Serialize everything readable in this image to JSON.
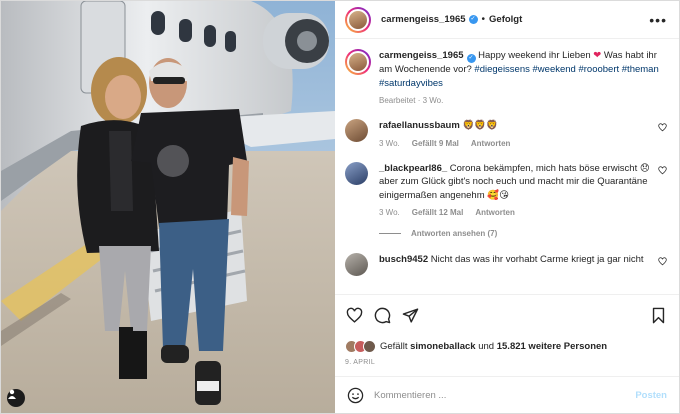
{
  "post": {
    "username": "carmengeiss_1965",
    "follow_status": "Gefolgt",
    "more_menu": "•••"
  },
  "caption": {
    "username": "carmengeiss_1965",
    "text": "Happy weekend ihr Lieben",
    "text2": "Was habt ihr am Wochenende vor?",
    "hashtags": "#diegeissens #weekend #rooobert #theman #saturdayvibes",
    "meta": "Bearbeitet · 3 Wo."
  },
  "comments": [
    {
      "username": "rafaellanussbaum",
      "text": "🦁🦁🦁",
      "age": "3 Wo.",
      "likes": "Gefällt 9 Mal",
      "reply": "Antworten"
    },
    {
      "username": "_blackpearl86_",
      "text": "Corona bekämpfen, mich hats böse erwischt 😞 aber zum Glück gibt's noch euch und macht mir die Quarantäne einigermaßen angenehm 🥰😘",
      "age": "3 Wo.",
      "likes": "Gefällt 12 Mal",
      "reply": "Antworten",
      "view_replies": "Antworten ansehen (7)"
    },
    {
      "username": "busch9452",
      "text": "Nicht das was ihr vorhabt Carme kriegt ja gar nicht"
    }
  ],
  "likes": {
    "prefix": "Gefällt",
    "user": "simoneballack",
    "middle": "und",
    "count": "15.821 weitere Personen"
  },
  "date": "9. APRIL",
  "add_comment": {
    "placeholder": "Kommentieren ...",
    "post_label": "Posten"
  },
  "colors": {
    "link": "#00376b",
    "verified": "#3897f0",
    "post_disabled": "#b2dffc",
    "muted": "#8e8e8e"
  },
  "icons": [
    "heart-icon",
    "comment-icon",
    "share-icon",
    "bookmark-icon",
    "emoji-icon",
    "user-tag-icon",
    "verified-badge-icon",
    "more-options-icon"
  ]
}
